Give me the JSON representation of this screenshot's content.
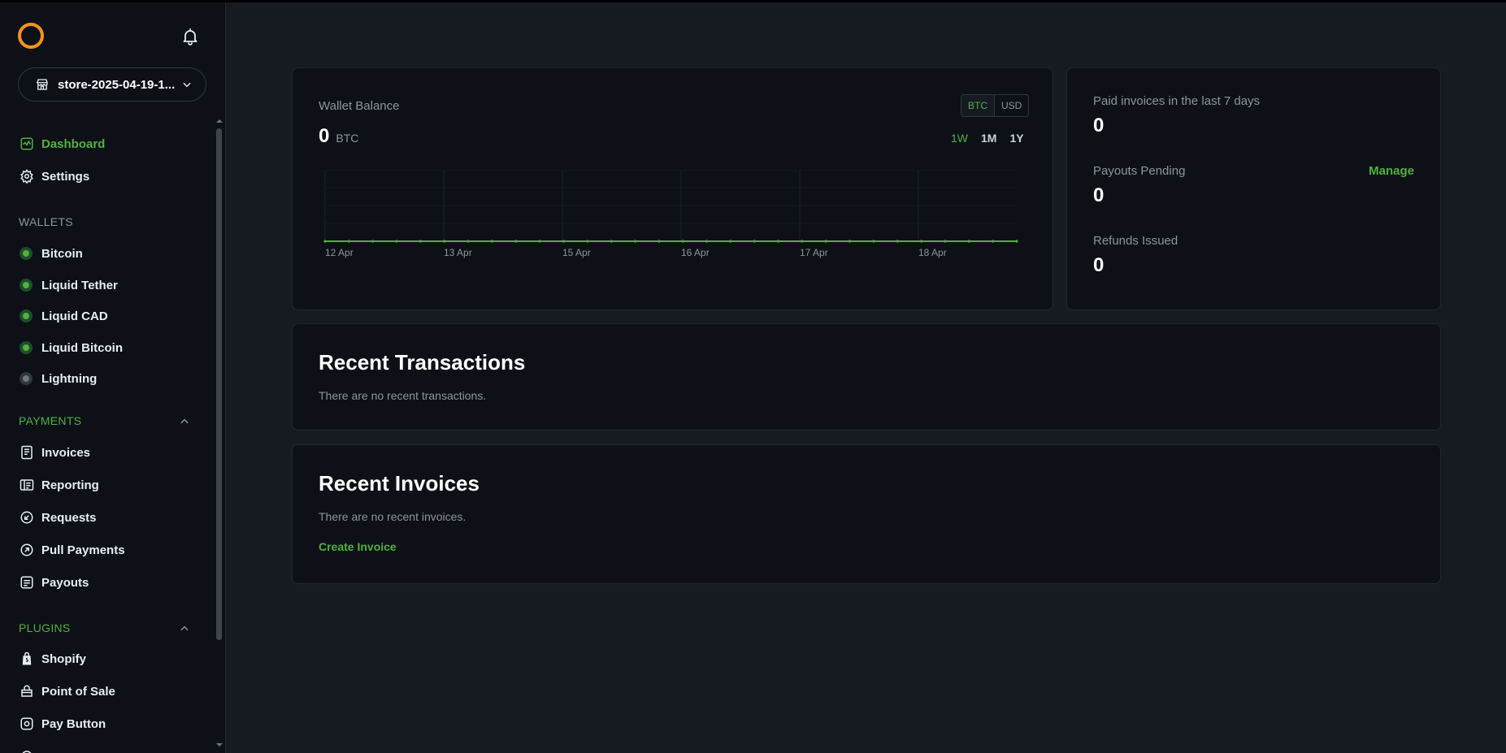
{
  "colors": {
    "accent": "#51b13e",
    "brand": "#f7931a",
    "bg": "#161b22",
    "panel": "#0d1117"
  },
  "header": {
    "logo_icon": "btcpay-logo-icon",
    "bell_icon": "bell-icon"
  },
  "store": {
    "name": "store-2025-04-19-1..."
  },
  "nav": {
    "dashboard": "Dashboard",
    "settings": "Settings",
    "wallets_heading": "WALLETS",
    "wallets": [
      {
        "label": "Bitcoin",
        "status": "online"
      },
      {
        "label": "Liquid Tether",
        "status": "online"
      },
      {
        "label": "Liquid CAD",
        "status": "online"
      },
      {
        "label": "Liquid Bitcoin",
        "status": "online"
      },
      {
        "label": "Lightning",
        "status": "offline"
      }
    ],
    "payments_heading": "PAYMENTS",
    "payments": [
      "Invoices",
      "Reporting",
      "Requests",
      "Pull Payments",
      "Payouts"
    ],
    "plugins_heading": "PLUGINS",
    "plugins": [
      "Shopify",
      "Point of Sale",
      "Pay Button"
    ]
  },
  "wallet_balance": {
    "title": "Wallet Balance",
    "amount": "0",
    "unit": "BTC",
    "currency_options": [
      "BTC",
      "USD"
    ],
    "currency_selected": "BTC",
    "ranges": [
      "1W",
      "1M",
      "1Y"
    ],
    "range_selected": "1W"
  },
  "chart_data": {
    "type": "line",
    "x": [
      "12 Apr",
      "13 Apr",
      "15 Apr",
      "16 Apr",
      "17 Apr",
      "18 Apr"
    ],
    "tick_labels": [
      "12 Apr",
      "13 Apr",
      "15 Apr",
      "16 Apr",
      "17 Apr",
      "18 Apr"
    ],
    "values": [
      0,
      0,
      0,
      0,
      0,
      0,
      0,
      0,
      0,
      0,
      0,
      0,
      0,
      0,
      0,
      0,
      0,
      0,
      0,
      0,
      0,
      0,
      0,
      0,
      0,
      0,
      0,
      0,
      0,
      0
    ],
    "grid": true
  },
  "stats": {
    "paid_label": "Paid invoices in the last 7 days",
    "paid_value": "0",
    "payouts_label": "Payouts Pending",
    "payouts_value": "0",
    "manage_label": "Manage",
    "refunds_label": "Refunds Issued",
    "refunds_value": "0"
  },
  "recent_transactions": {
    "title": "Recent Transactions",
    "empty": "There are no recent transactions."
  },
  "recent_invoices": {
    "title": "Recent Invoices",
    "empty": "There are no recent invoices.",
    "create": "Create Invoice"
  }
}
